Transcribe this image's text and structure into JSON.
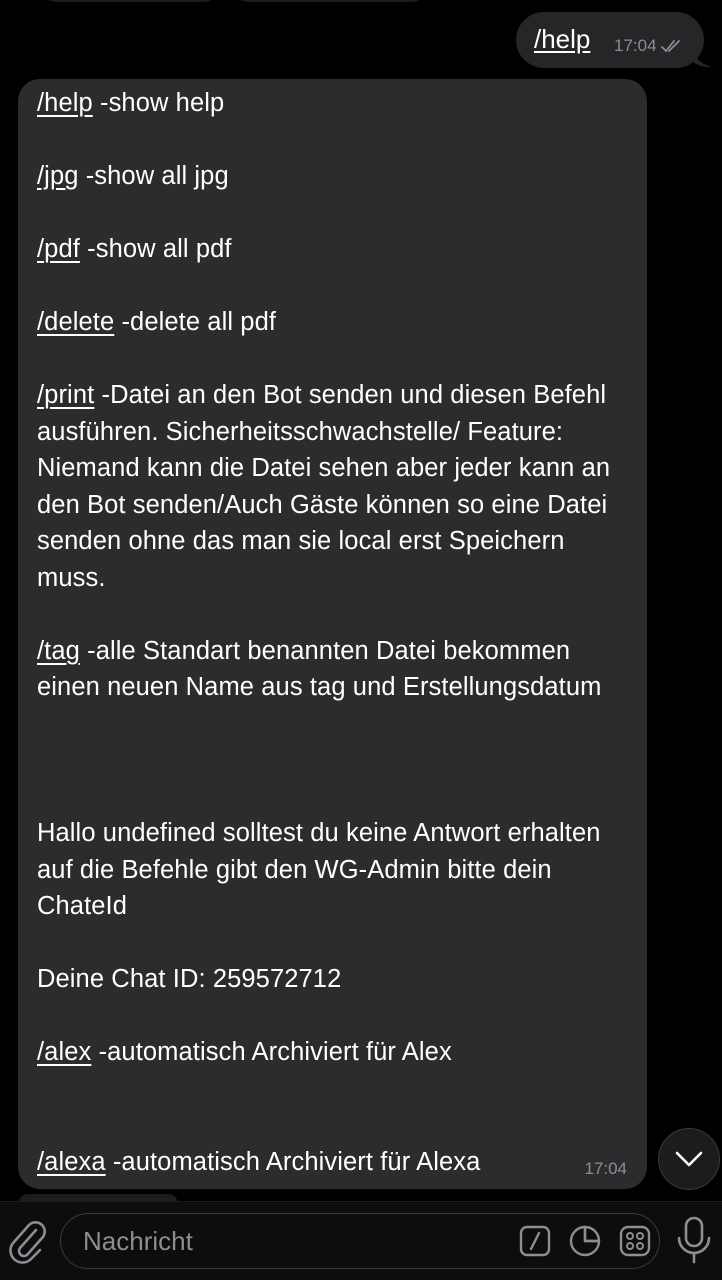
{
  "outgoing": {
    "text": "/help",
    "time": "17:04"
  },
  "incoming": {
    "lines": [
      {
        "cmd": "/help",
        "text": " -show help"
      },
      {
        "cmd": "/jpg",
        "text": " -show all jpg"
      },
      {
        "cmd": "/pdf",
        "text": " -show all pdf"
      },
      {
        "cmd": "/delete",
        "text": " -delete all pdf"
      },
      {
        "cmd": "/print",
        "text": " -Datei an den Bot senden und diesen Befehl ausführen. Sicherheitsschwachstelle/ Feature: Niemand kann die Datei sehen aber jeder kann an den Bot senden/Auch Gäste können so eine Datei senden ohne das man sie local erst Speichern muss."
      },
      {
        "cmd": "/tag",
        "text": " -alle Standart benannten Datei bekommen einen neuen Name aus tag und Erstellungsdatum"
      }
    ],
    "info": "Hallo undefined solltest du keine Antwort erhalten auf die Befehle gibt den WG-Admin bitte dein ChateId",
    "chat_id": "Deine Chat ID: 259572712",
    "alex": {
      "cmd": "/alex",
      "text": " -automatisch Archiviert für Alex"
    },
    "alexa": {
      "cmd": "/alexa",
      "text": " -automatisch Archiviert für Alexa"
    },
    "time": "17:04"
  },
  "composer": {
    "placeholder": "Nachricht"
  },
  "icons": {
    "attach": "paperclip-icon",
    "command": "slash-command-icon",
    "sticker": "sticker-icon",
    "bot_menu": "grid-menu-icon",
    "voice": "microphone-icon",
    "scroll_down": "chevron-down-icon"
  },
  "colors": {
    "background": "#000000",
    "bubble": "#2c2c2e",
    "timestamp": "#8d8d93",
    "text": "#ffffff"
  }
}
